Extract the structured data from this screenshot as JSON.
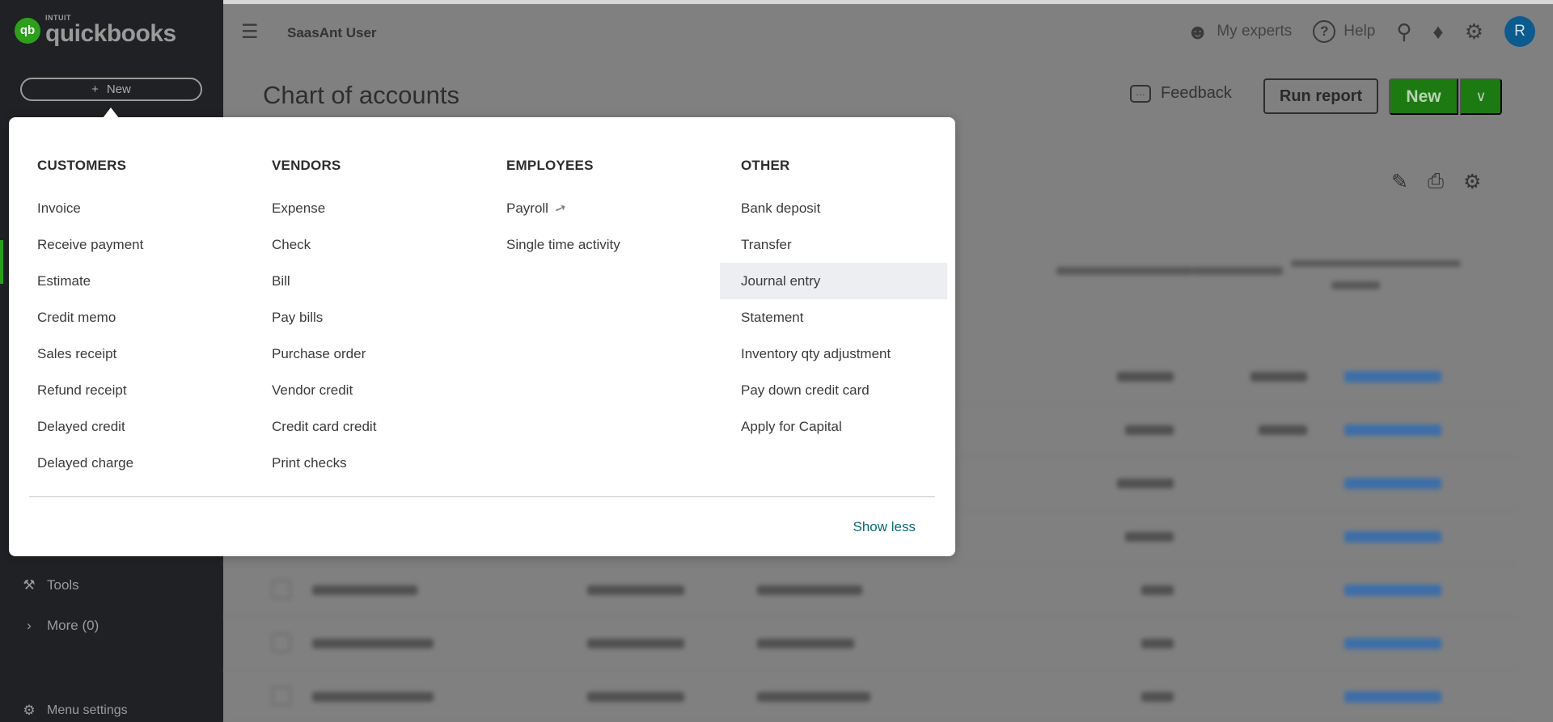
{
  "sidebar": {
    "logo_brand": "INTUIT",
    "logo_name": "quickbooks",
    "logo_mark": "qb",
    "new_label": "New",
    "new_icon": "+",
    "tools_label": "Tools",
    "more_label": "More (0)",
    "menu_settings_label": "Menu settings"
  },
  "topbar": {
    "company_name": "SaasAnt User",
    "my_experts_label": "My experts",
    "help_label": "Help",
    "avatar_initial": "R"
  },
  "page": {
    "title": "Chart of accounts",
    "feedback_label": "Feedback",
    "run_report_label": "Run report",
    "new_button_label": "New"
  },
  "menu": {
    "columns": [
      {
        "heading": "CUSTOMERS",
        "items": [
          "Invoice",
          "Receive payment",
          "Estimate",
          "Credit memo",
          "Sales receipt",
          "Refund receipt",
          "Delayed credit",
          "Delayed charge"
        ]
      },
      {
        "heading": "VENDORS",
        "items": [
          "Expense",
          "Check",
          "Bill",
          "Pay bills",
          "Purchase order",
          "Vendor credit",
          "Credit card credit",
          "Print checks"
        ]
      },
      {
        "heading": "EMPLOYEES",
        "items": [
          "Payroll",
          "Single time activity"
        ]
      },
      {
        "heading": "OTHER",
        "items": [
          "Bank deposit",
          "Transfer",
          "Journal entry",
          "Statement",
          "Inventory qty adjustment",
          "Pay down credit card",
          "Apply for Capital"
        ]
      }
    ],
    "highlighted_item": "Journal entry",
    "show_less_label": "Show less"
  },
  "colors": {
    "sidebar_bg": "#1f2124",
    "brand_green": "#2ca01c",
    "new_button_green": "#1d7a12",
    "link_teal": "#0a6a70",
    "avatar_blue": "#0b5b8e"
  },
  "icons": [
    "hamburger-icon",
    "my-experts-icon",
    "help-icon",
    "search-icon",
    "bell-icon",
    "gear-icon",
    "feedback-icon",
    "chevron-down-icon",
    "pencil-icon",
    "print-icon",
    "settings-icon",
    "tools-icon",
    "chevron-right-icon",
    "payroll-upgrade-icon"
  ]
}
